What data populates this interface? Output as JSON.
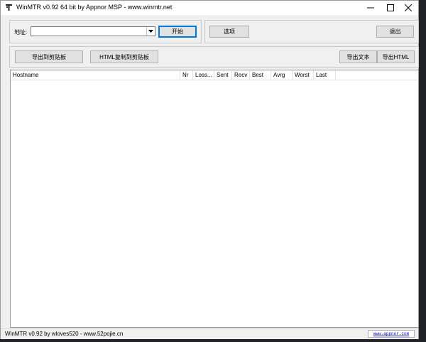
{
  "window": {
    "title": "WinMTR v0.92 64 bit by Appnor MSP - www.winmtr.net"
  },
  "address": {
    "label": "地址:",
    "value": "",
    "placeholder": ""
  },
  "buttons": {
    "start": "开始",
    "options": "选项",
    "exit": "退出",
    "copy_text": "导出到剪贴板",
    "copy_html": "HTML复制到剪贴板",
    "export_text": "导出文本",
    "export_html": "导出HTML"
  },
  "table": {
    "columns": [
      "Hostname",
      "Nr",
      "Loss...",
      "Sent",
      "Recv",
      "Best",
      "Avrg",
      "Worst",
      "Last"
    ],
    "rows": []
  },
  "status": {
    "text": "WinMTR v0.92 by wloves520 - www.52pojie.cn",
    "link": "www.appnor.com"
  },
  "icons": {
    "app": "winmtr-app-icon",
    "minimize": "minimize-icon",
    "maximize": "maximize-icon",
    "close": "close-icon",
    "dropdown": "chevron-down-icon"
  }
}
